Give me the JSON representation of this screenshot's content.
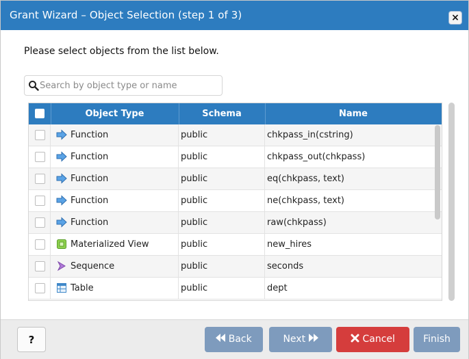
{
  "dialog": {
    "title": "Grant Wizard – Object Selection (step 1 of 3)",
    "close_label": "×"
  },
  "instruction": "Please select objects from the list below.",
  "search": {
    "placeholder": "Search by object type or name",
    "value": ""
  },
  "grid": {
    "columns": [
      "Object Type",
      "Schema",
      "Name"
    ],
    "rows": [
      {
        "type": "Function",
        "icon": "function-icon",
        "schema": "public",
        "name": "chkpass_in(cstring)",
        "checked": false
      },
      {
        "type": "Function",
        "icon": "function-icon",
        "schema": "public",
        "name": "chkpass_out(chkpass)",
        "checked": false
      },
      {
        "type": "Function",
        "icon": "function-icon",
        "schema": "public",
        "name": "eq(chkpass, text)",
        "checked": false
      },
      {
        "type": "Function",
        "icon": "function-icon",
        "schema": "public",
        "name": "ne(chkpass, text)",
        "checked": false
      },
      {
        "type": "Function",
        "icon": "function-icon",
        "schema": "public",
        "name": "raw(chkpass)",
        "checked": false
      },
      {
        "type": "Materialized View",
        "icon": "materialized-view-icon",
        "schema": "public",
        "name": "new_hires",
        "checked": false
      },
      {
        "type": "Sequence",
        "icon": "sequence-icon",
        "schema": "public",
        "name": "seconds",
        "checked": false
      },
      {
        "type": "Table",
        "icon": "table-icon",
        "schema": "public",
        "name": "dept",
        "checked": false
      }
    ]
  },
  "footer": {
    "help_label": "?",
    "back_label": "Back",
    "next_label": "Next",
    "cancel_label": "Cancel",
    "finish_label": "Finish"
  },
  "colors": {
    "header_blue": "#2d7cbf",
    "button_disabled": "#7e9bbd",
    "cancel_red": "#d53d3c"
  }
}
